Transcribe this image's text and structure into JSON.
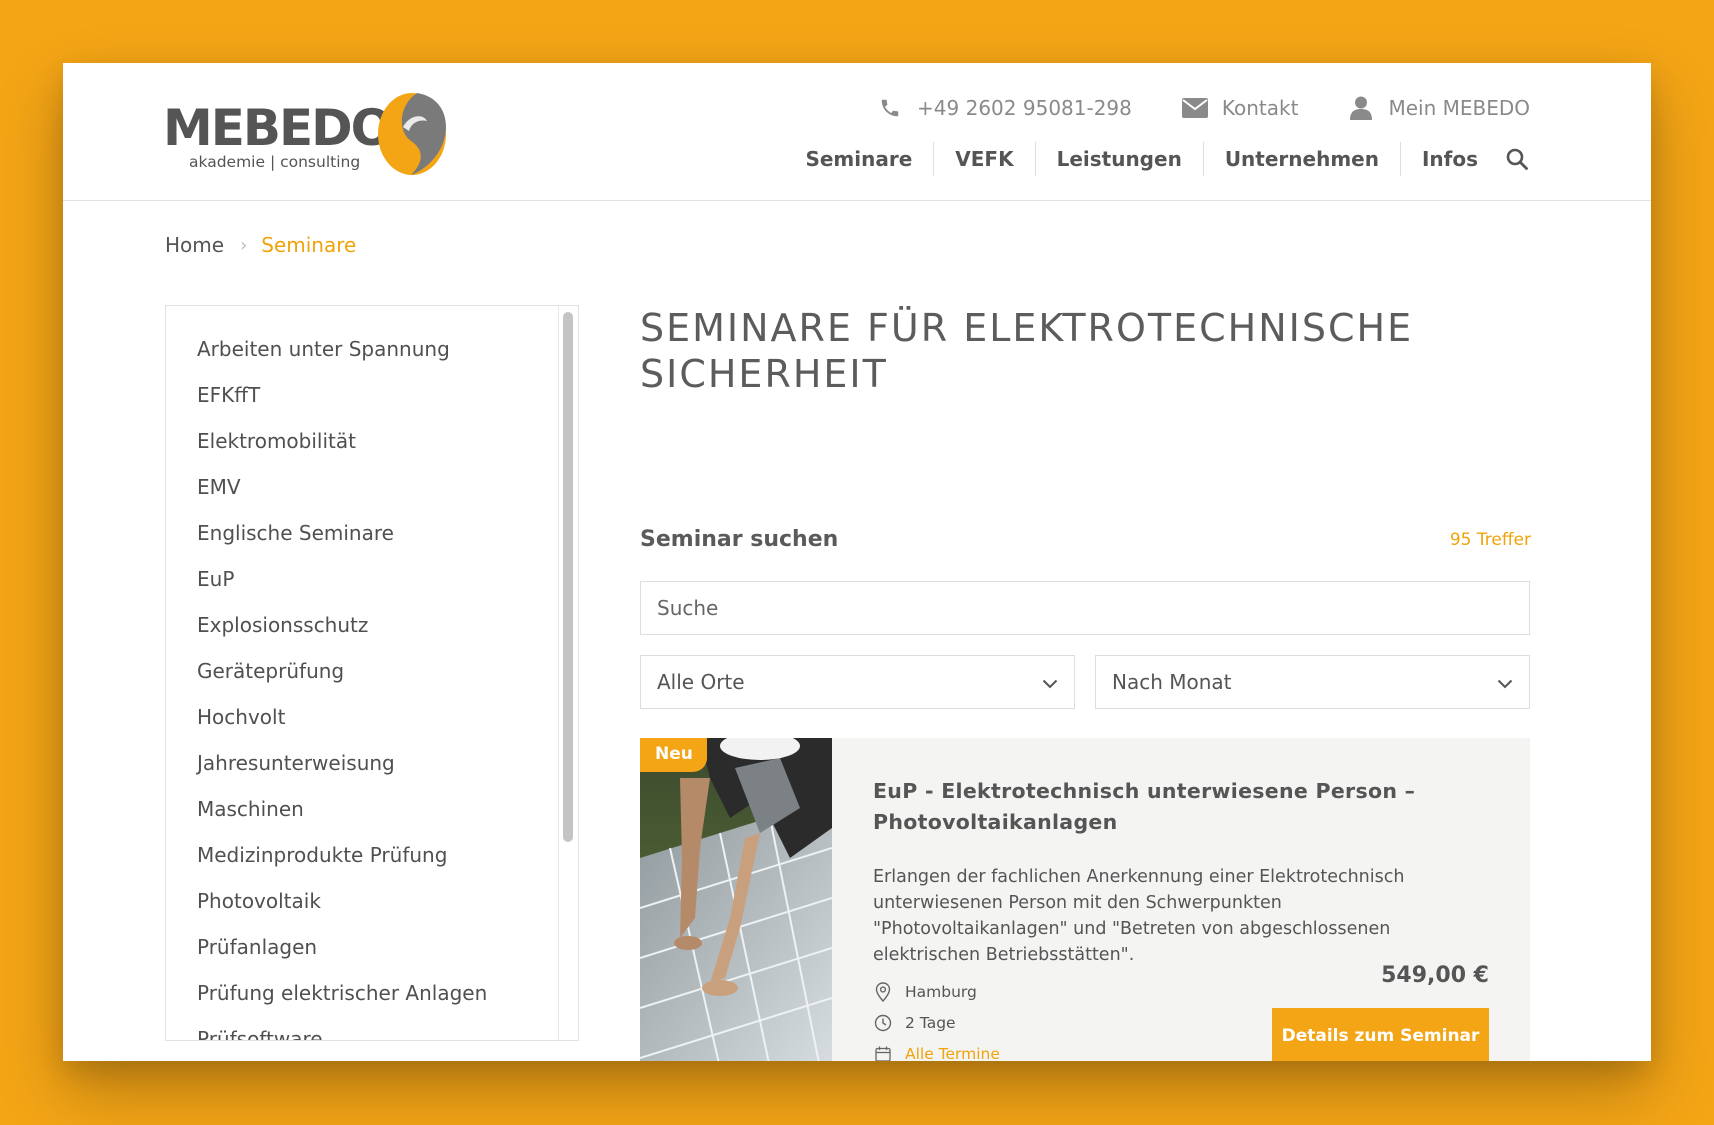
{
  "brand": {
    "name": "MEBEDO",
    "tagline": "akademie | consulting",
    "colors": {
      "accent": "#f4a516",
      "text": "#555555",
      "link": "#f0a30a"
    }
  },
  "topbar": {
    "phone": {
      "icon": "phone-icon",
      "label": "+49 2602 95081-298"
    },
    "contact": {
      "icon": "envelope-icon",
      "label": "Kontakt"
    },
    "account": {
      "icon": "user-icon",
      "label": "Mein MEBEDO"
    }
  },
  "nav": {
    "items": [
      "Seminare",
      "VEFK",
      "Leistungen",
      "Unternehmen",
      "Infos"
    ],
    "search_icon": "search-icon"
  },
  "breadcrumb": {
    "home": "Home",
    "current": "Seminare"
  },
  "sidebar": {
    "items": [
      "Arbeiten unter Spannung",
      "EFKffT",
      "Elektromobilität",
      "EMV",
      "Englische Seminare",
      "EuP",
      "Explosionsschutz",
      "Geräteprüfung",
      "Hochvolt",
      "Jahresunterweisung",
      "Maschinen",
      "Medizinprodukte Prüfung",
      "Photovoltaik",
      "Prüfanlagen",
      "Prüfung elektrischer Anlagen",
      "Prüfsoftware"
    ]
  },
  "main": {
    "title": "SEMINARE FÜR ELEKTROTECHNISCHE SICHERHEIT",
    "search_heading": "Seminar suchen",
    "hits": "95 Treffer",
    "search_placeholder": "Suche",
    "filter_location": "Alle Orte",
    "filter_month": "Nach Monat"
  },
  "card": {
    "badge": "Neu",
    "title": "EuP - Elektrotechnisch unterwiesene Person – Photovoltaikanlagen",
    "description": "Erlangen der fachlichen Anerkennung einer Elektrotechnisch unterwiesenen Person mit den Schwerpunkten \"Photovoltaikanlagen\" und \"Betreten von abgeschlossenen elektrischen Betriebsstätten\".",
    "location": "Hamburg",
    "duration": "2 Tage",
    "dates_link": "Alle Termine",
    "price": "549,00 €",
    "cta": "Details zum Seminar"
  }
}
